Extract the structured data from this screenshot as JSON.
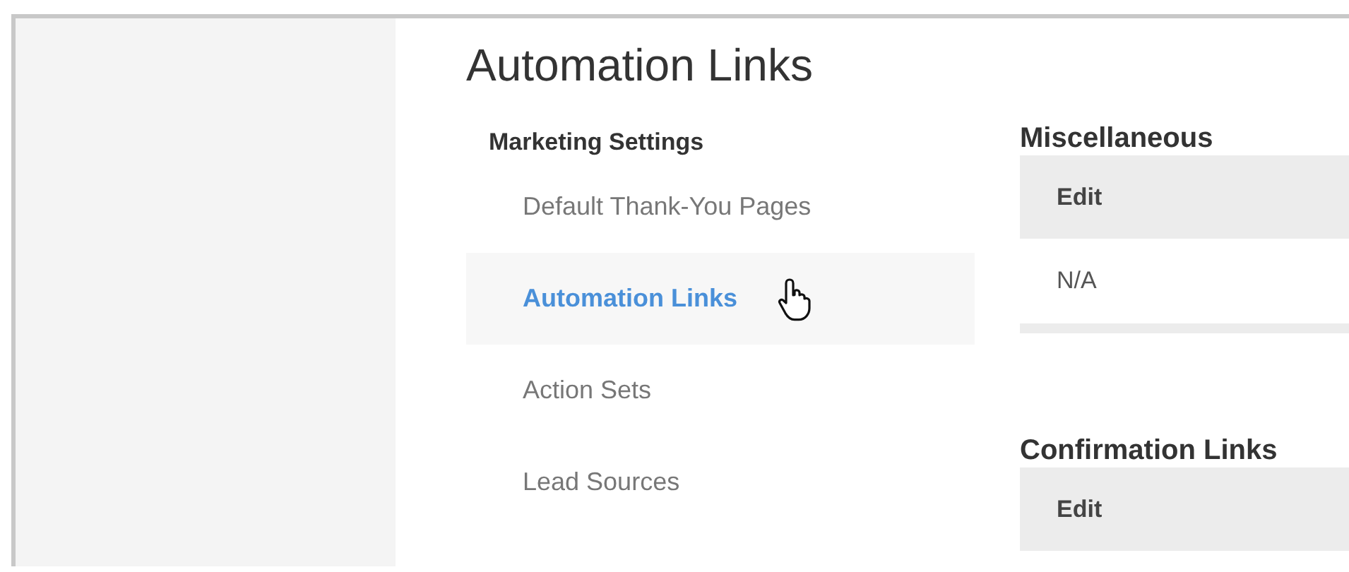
{
  "page": {
    "title": "Automation Links"
  },
  "sidebar": {
    "heading": "Marketing Settings",
    "items": [
      {
        "label": "Default Thank-You Pages",
        "selected": false
      },
      {
        "label": "Automation Links",
        "selected": true
      },
      {
        "label": "Action Sets",
        "selected": false
      },
      {
        "label": "Lead Sources",
        "selected": false
      }
    ]
  },
  "sections": [
    {
      "title": "Miscellaneous",
      "header": "Edit",
      "rows": [
        "N/A"
      ]
    },
    {
      "title": "Confirmation Links",
      "header": "Edit"
    }
  ]
}
